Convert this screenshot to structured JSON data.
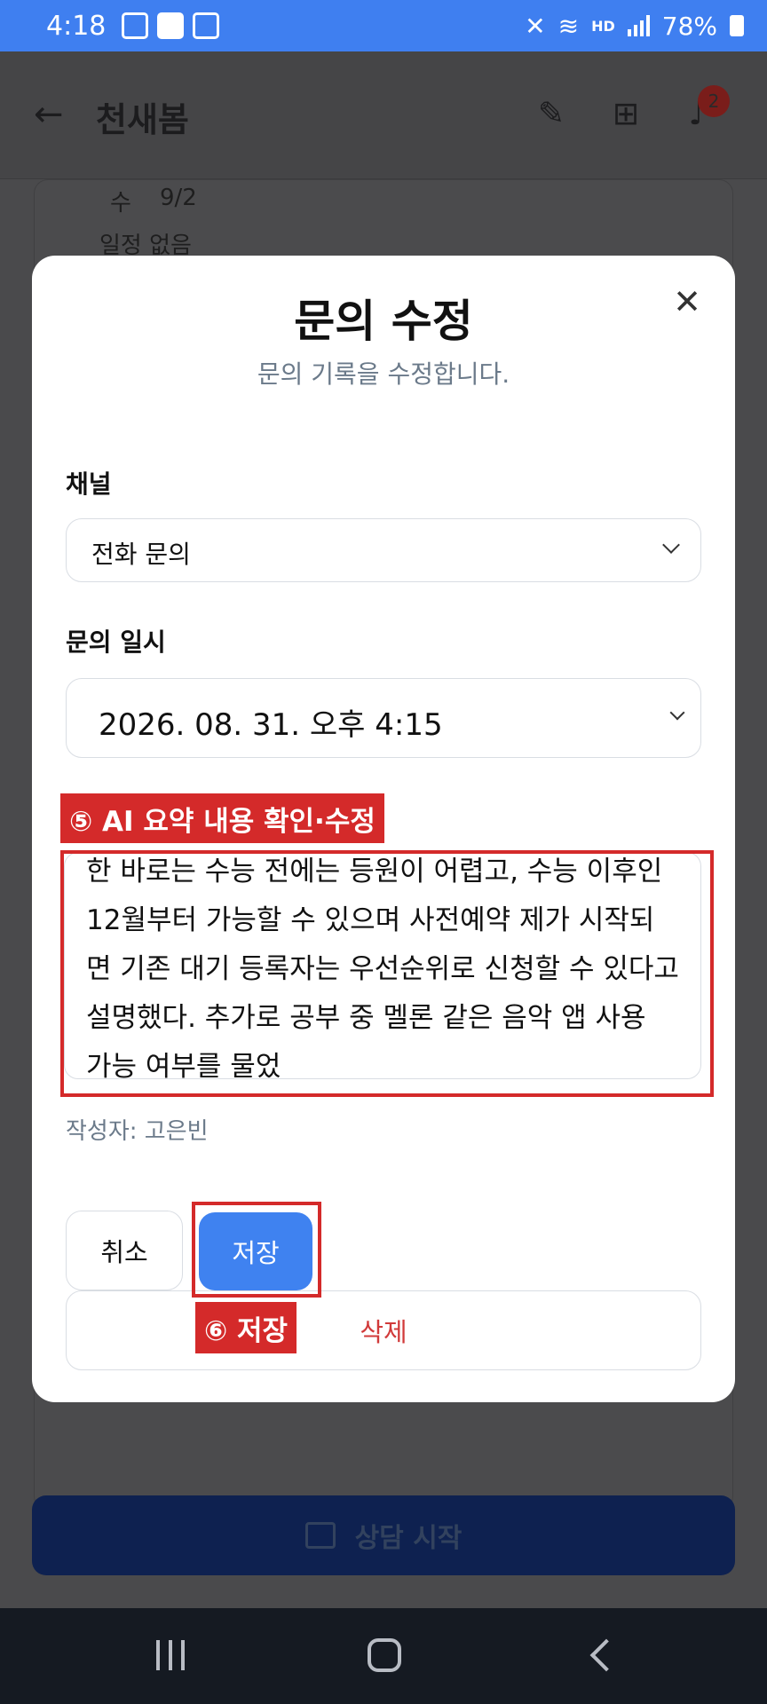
{
  "status_bar": {
    "time": "4:18",
    "network": "HD",
    "battery": "78%"
  },
  "app": {
    "title": "천새봄",
    "notification_count": "2",
    "schedule_day": "수",
    "schedule_date": "9/2",
    "no_schedule": "일정 없음",
    "consult_button": "상담 시작"
  },
  "modal": {
    "title": "문의 수정",
    "subtitle": "문의 기록을 수정합니다.",
    "close_icon": "close-icon",
    "channel_label": "채널",
    "channel_value": "전화 문의",
    "datetime_label": "문의 일시",
    "datetime_value": "2026. 08. 31. 오후 4:15",
    "summary_text": "한 바로는 수능 전에는 등원이 어렵고, 수능 이후인 12월부터 가능할 수 있으며 사전예약 제가 시작되면 기존 대기 등록자는 우선순위로 신청할 수 있다고 설명했다. 추가로 공부 중 멜론 같은 음악 앱 사용 가능 여부를 물었",
    "author": "작성자: 고은빈",
    "cancel_label": "취소",
    "save_label": "저장",
    "delete_label": "삭제"
  },
  "annotations": {
    "step5": "⑤ AI 요약 내용 확인·수정",
    "step6": "⑥ 저장",
    "color": "#d42a2a"
  },
  "colors": {
    "accent": "#3f82f0",
    "status_bar": "#3f7ff0",
    "danger": "#d13a3a"
  }
}
